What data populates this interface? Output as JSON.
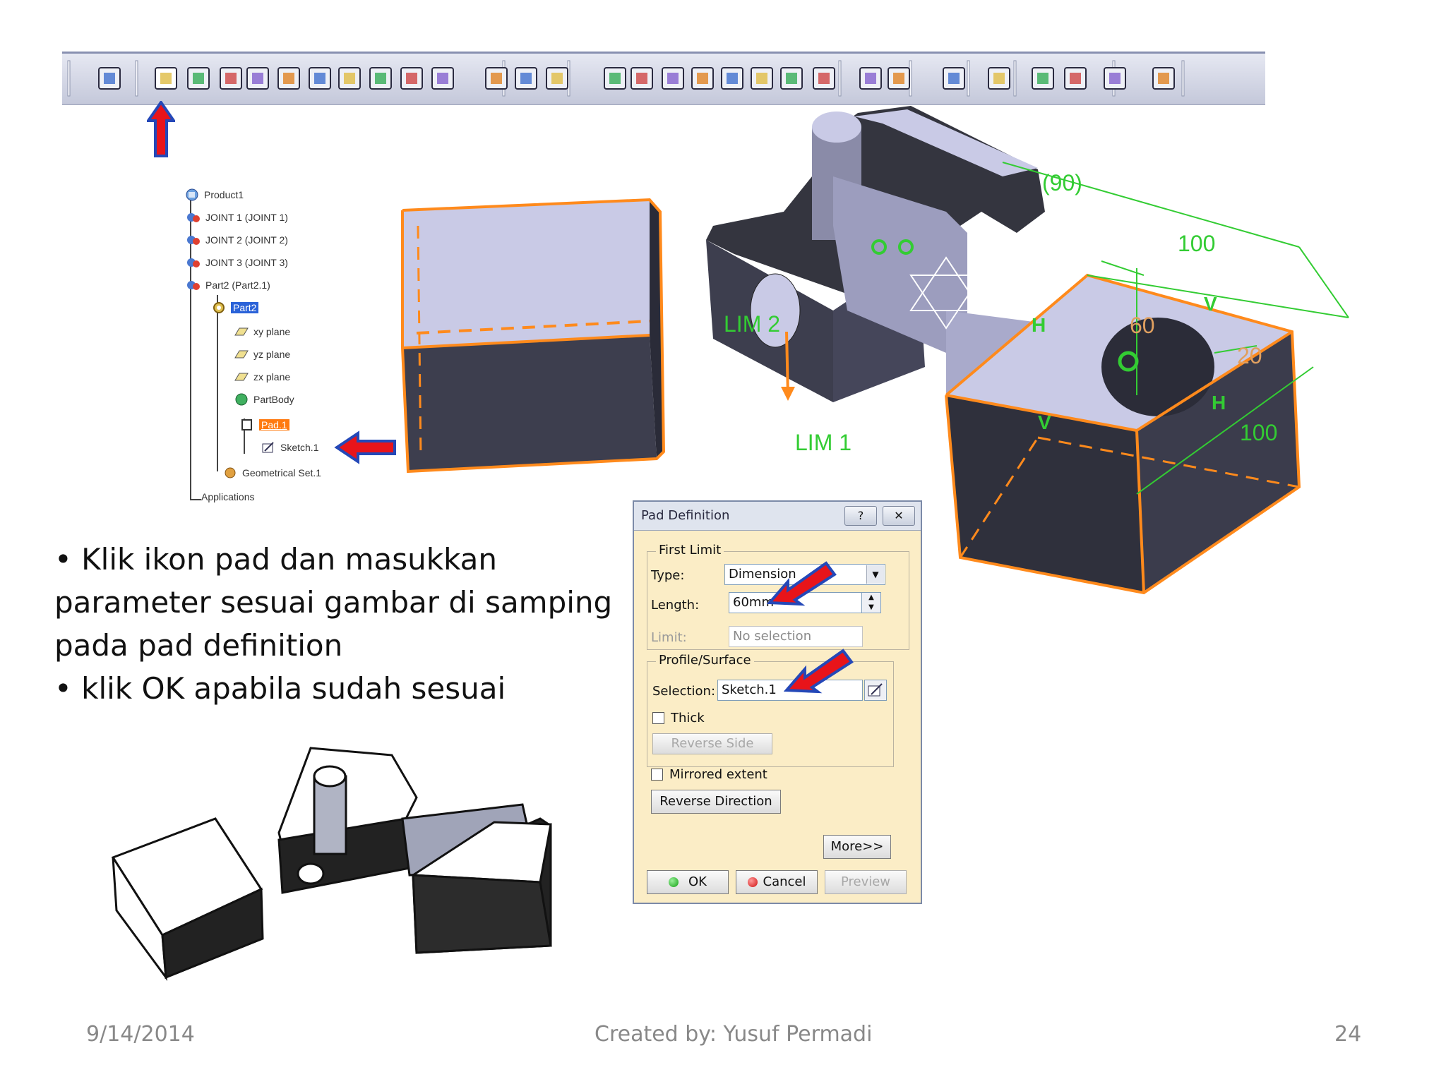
{
  "toolbar": {
    "icons": [
      "sketcher-icon",
      "pad-icon",
      "pocket-icon",
      "shaft-icon",
      "groove-icon",
      "hole-icon",
      "rib-icon",
      "slot-icon",
      "stiffener-icon",
      "multi-section-icon",
      "removed-multi-section-icon",
      "solid-combine-icon",
      "constraint-icon",
      "catalog-icon",
      "tree-icon",
      "edge-fillet-icon",
      "chamfer-icon",
      "draft-icon",
      "shell-icon",
      "thickness-icon",
      "thread-icon",
      "split-icon",
      "translation-icon",
      "mirror-icon",
      "add-icon",
      "color-icon",
      "measure-icon",
      "grid-icon",
      "apply-material-icon",
      "fit-all-icon"
    ]
  },
  "tree": {
    "product": "Product1",
    "joint1": "JOINT 1 (JOINT 1)",
    "joint2": "JOINT 2 (JOINT 2)",
    "joint3": "JOINT 3 (JOINT 3)",
    "part2": "Part2 (Part2.1)",
    "part2_node": "Part2",
    "xy_plane": "xy plane",
    "yz_plane": "yz plane",
    "zx_plane": "zx plane",
    "partbody": "PartBody",
    "pad": "Pad.1",
    "sketch": "Sketch.1",
    "geoset": "Geometrical Set.1",
    "applications": "Applications"
  },
  "bullets": {
    "line1": "• Klik ikon pad dan masukkan",
    "line2": "parameter sesuai gambar di samping",
    "line3": "pada pad definition",
    "line4": "• klik OK apabila sudah sesuai"
  },
  "viewport": {
    "dim_90": "(90)",
    "dim_100_top": "100",
    "dim_60": "60",
    "dim_20": "20",
    "dim_100_bottom": "100",
    "lim2": "LIM 2",
    "lim1": "LIM 1",
    "constraint_h": "H",
    "constraint_v": "V"
  },
  "dialog": {
    "title": "Pad Definition",
    "help_btn": "?",
    "close_btn": "✕",
    "first_limit": "First Limit",
    "type_label": "Type:",
    "type_value": "Dimension",
    "length_label": "Length:",
    "length_value": "60mm",
    "limit_label": "Limit:",
    "limit_value": "No selection",
    "profile_surface": "Profile/Surface",
    "selection_label": "Selection:",
    "selection_value": "Sketch.1",
    "thick_label": "Thick",
    "reverse_side": "Reverse Side",
    "mirrored_extent": "Mirrored extent",
    "reverse_direction": "Reverse Direction",
    "more": "More>>",
    "ok": "OK",
    "cancel": "Cancel",
    "preview": "Preview"
  },
  "footer": {
    "date": "9/14/2014",
    "credit": "Created by: Yusuf Permadi",
    "page": "24"
  },
  "colors": {
    "arrow_red": "#e8141a",
    "arrow_blue": "#2448b8",
    "highlight_orange": "#ff8a1c",
    "dimension_green": "#33cc33",
    "face_lavender": "#c9cae6",
    "face_dark": "#3d3e4e"
  }
}
